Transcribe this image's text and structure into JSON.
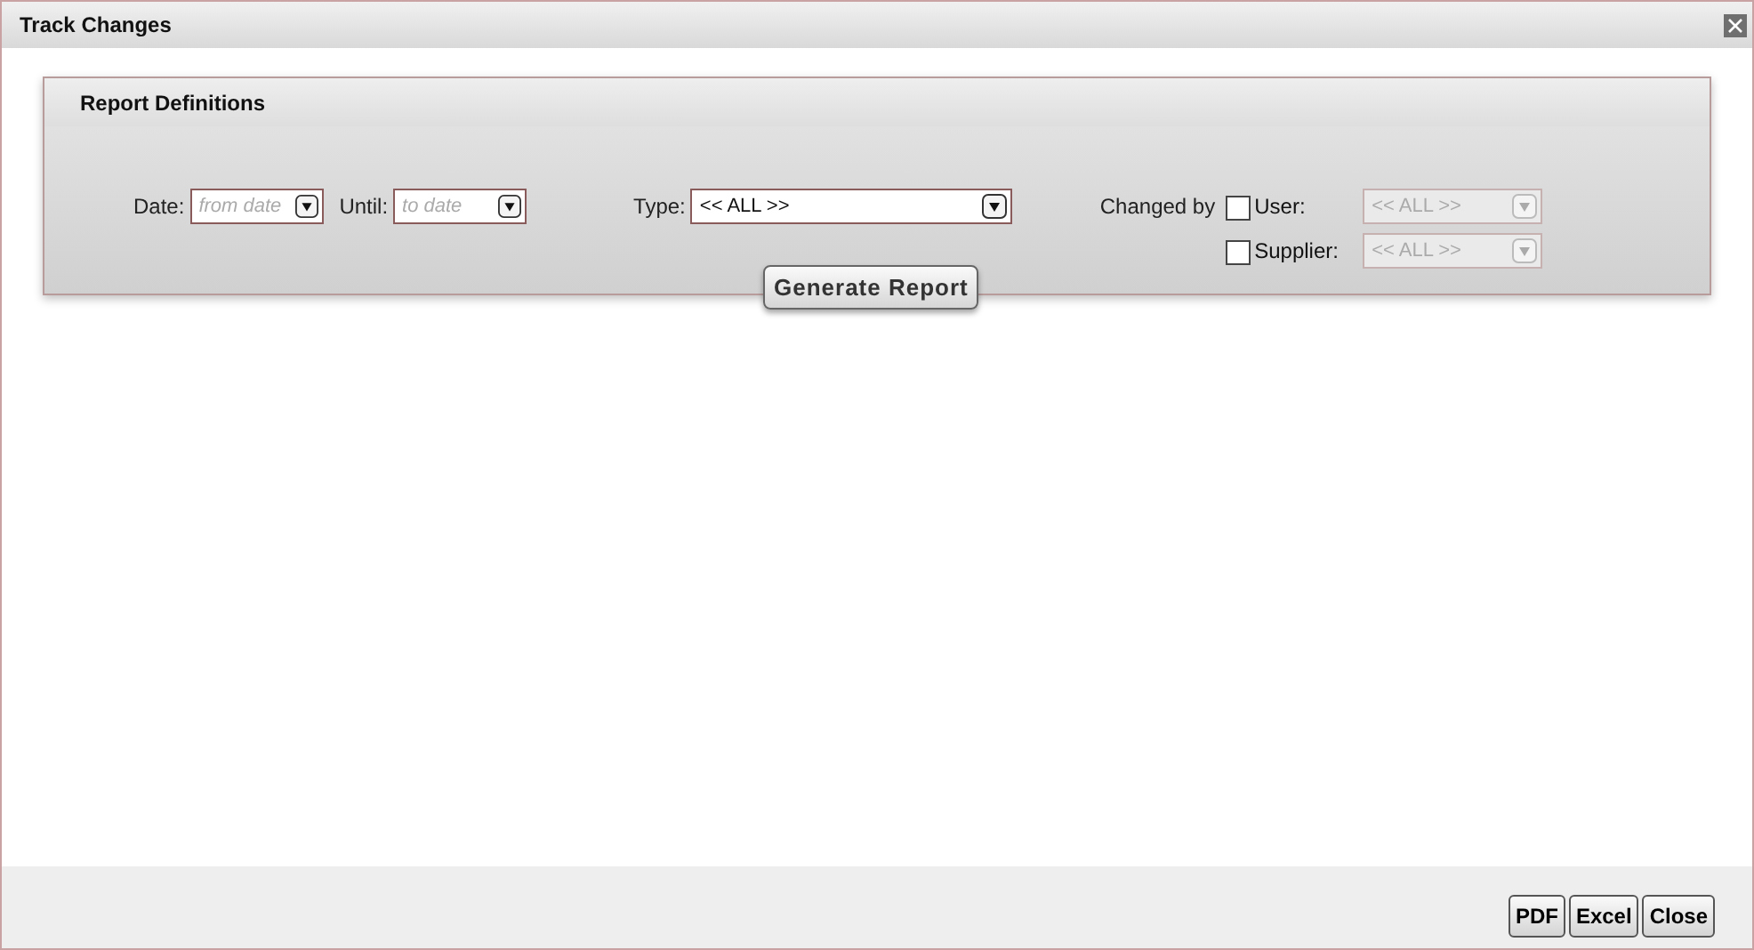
{
  "window": {
    "title": "Track Changes"
  },
  "panel": {
    "title": "Report Definitions",
    "date": {
      "label": "Date:",
      "placeholder": "from date"
    },
    "until": {
      "label": "Until:",
      "placeholder": "to date"
    },
    "type": {
      "label": "Type:",
      "value": "<< ALL >>",
      "disabled": false
    },
    "changed_by": {
      "label": "Changed by",
      "filters": [
        {
          "label": "User:",
          "checked": false,
          "value": "<< ALL >>",
          "disabled": true
        },
        {
          "label": "Supplier:",
          "checked": false,
          "value": "<< ALL >>",
          "disabled": true
        }
      ]
    },
    "generate_button": "Generate Report"
  },
  "footer_buttons": [
    "PDF",
    "Excel",
    "Close"
  ]
}
